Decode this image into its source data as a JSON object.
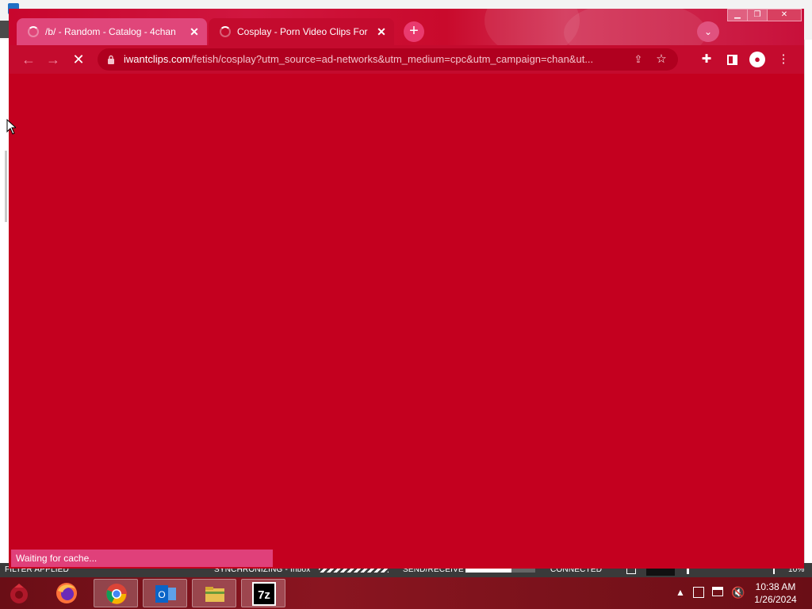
{
  "browser": {
    "tabs": [
      {
        "title": "/b/ - Random - Catalog - 4chan",
        "state": "loading",
        "active": false
      },
      {
        "title": "Cosplay - Porn Video Clips For Sa",
        "state": "loading",
        "active": true
      }
    ],
    "new_tab_icon": "plus-icon",
    "address": {
      "host": "iwantclips.com",
      "path": "/fetish/cosplay?utm_source=ad-networks&utm_medium=cpc&utm_campaign=chan&ut..."
    },
    "status_text": "Waiting for cache...",
    "theme_color": "#c4001f"
  },
  "outlook_status": {
    "filter": "FILTER APPLIED",
    "sync": "SYNCHRONIZING - Inbox",
    "sendreceive": "SEND/RECEIVE",
    "connection": "CONNECTED",
    "zoom": "10%"
  },
  "taskbar": {
    "apps": [
      "firefox",
      "chrome",
      "outlook",
      "file-explorer",
      "7zip"
    ],
    "sevenzip_label": "7z",
    "outlook_label": "O",
    "time": "10:38 AM",
    "date": "1/26/2024"
  }
}
